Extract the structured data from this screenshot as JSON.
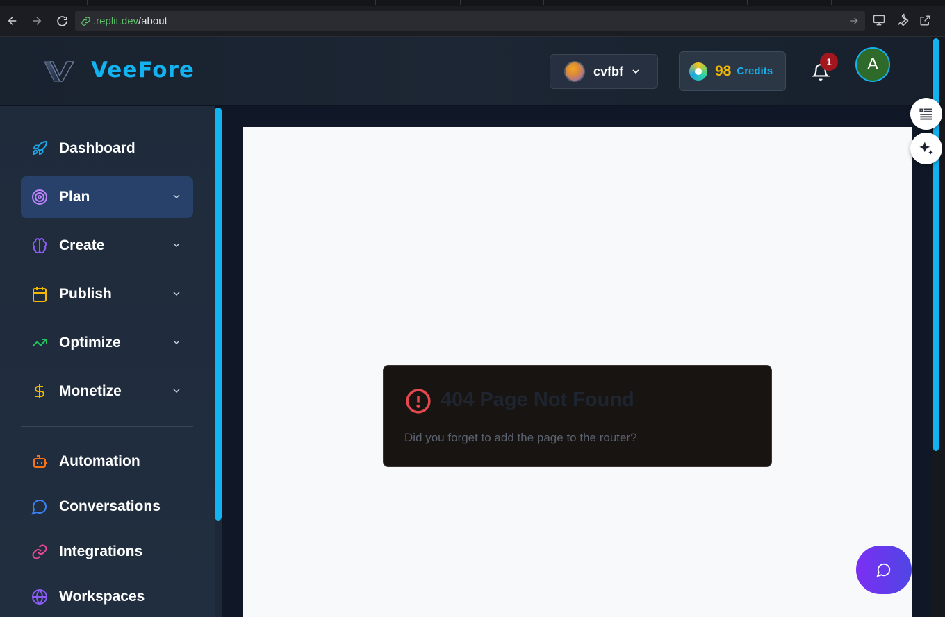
{
  "browser": {
    "url_host": ".replit.dev",
    "url_path": "/about"
  },
  "header": {
    "brand": "VeeFore",
    "workspace": {
      "name": "cvfbf"
    },
    "credits": {
      "value": "98",
      "label": "Credits"
    },
    "notifications": {
      "count": "1"
    },
    "user": {
      "initial": "A"
    }
  },
  "sidebar": {
    "items": [
      {
        "label": "Dashboard",
        "icon": "rocket-icon",
        "color": "#1ea7e8"
      },
      {
        "label": "Plan",
        "icon": "target-icon",
        "color": "#c084fc",
        "active": true
      },
      {
        "label": "Create",
        "icon": "brain-icon",
        "color": "#8b5cf6"
      },
      {
        "label": "Publish",
        "icon": "calendar-icon",
        "color": "#f5b800"
      },
      {
        "label": "Optimize",
        "icon": "trending-up-icon",
        "color": "#22c55e"
      },
      {
        "label": "Monetize",
        "icon": "dollar-icon",
        "color": "#f5b800"
      },
      {
        "label": "Automation",
        "icon": "robot-icon",
        "color": "#f97316"
      },
      {
        "label": "Conversations",
        "icon": "message-circle-icon",
        "color": "#3b82f6"
      },
      {
        "label": "Integrations",
        "icon": "link-icon",
        "color": "#ec4899"
      },
      {
        "label": "Workspaces",
        "icon": "globe-icon",
        "color": "#8b5cf6"
      }
    ]
  },
  "error": {
    "title": "404 Page Not Found",
    "message": "Did you forget to add the page to the router?"
  },
  "colors": {
    "accent": "#12b3f0",
    "error": "#e5484d",
    "fab_start": "#7b2ff2",
    "fab_end": "#4f46e5"
  }
}
